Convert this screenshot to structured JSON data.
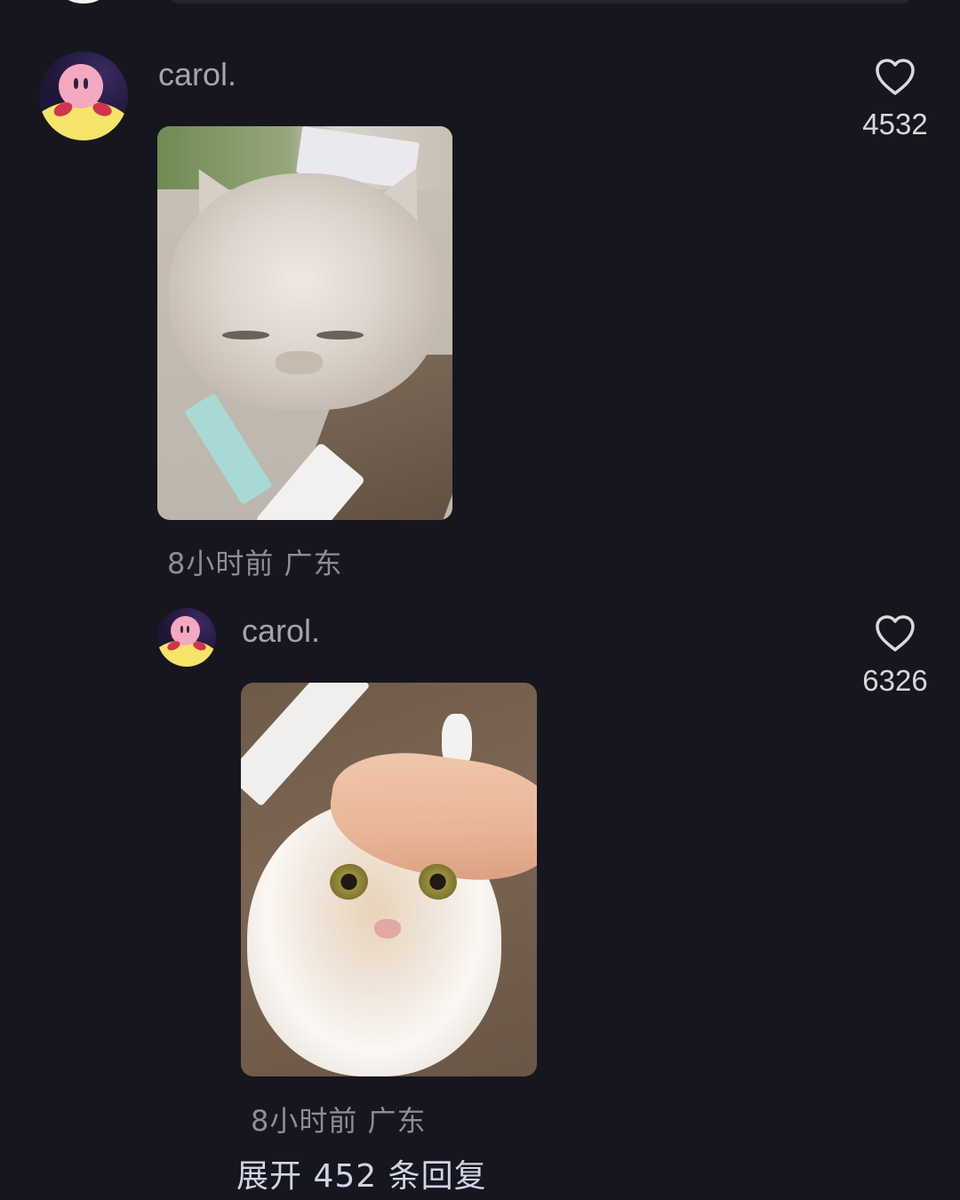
{
  "comment": {
    "username": "carol.",
    "meta": "8小时前 广东",
    "likes": "4532",
    "photo_desc_icon": "cat-photo-icon"
  },
  "reply": {
    "username": "carol.",
    "meta": "8小时前 广东",
    "likes": "6326",
    "photo_desc_icon": "cat-photo-icon"
  },
  "expand_replies": "展开 452 条回复",
  "colors": {
    "background": "#16161e",
    "username": "#a4a4ab",
    "meta": "#8d8d95",
    "likes": "#d8d8dc",
    "expand": "#cfd5e6"
  },
  "icons": {
    "like": "heart-outline-icon"
  }
}
